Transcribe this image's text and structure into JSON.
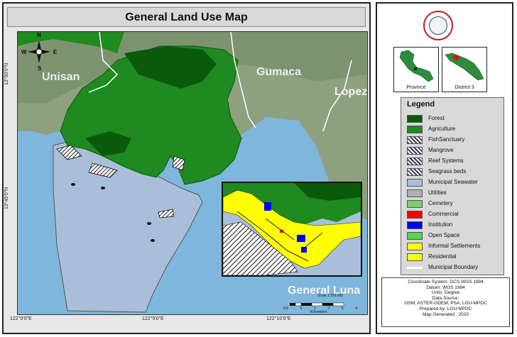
{
  "map": {
    "title": "General Land Use Map",
    "places": {
      "unisan": "Unisan",
      "gumaca": "Gumaca",
      "lopez": "Lopez",
      "general_luna": "General Luna"
    },
    "compass": {
      "n": "N",
      "s": "S",
      "e": "E",
      "w": "W"
    },
    "lat_labels": [
      "13°50'0\"N",
      "13°45'0\"N"
    ],
    "lon_labels": [
      "122°0'0\"E",
      "122°5'0\"E",
      "122°10'0\"E"
    ],
    "scale": {
      "text": "Scale 1:150,000",
      "ticks": [
        "0.5",
        "0",
        "1",
        "2",
        "3",
        "4"
      ],
      "unit": "Kilometers"
    }
  },
  "locator": {
    "province_label": "Province",
    "district_label": "District 3"
  },
  "legend": {
    "title": "Legend",
    "items": [
      {
        "label": "Forest",
        "color": "#0b5a0b",
        "pattern": "solid"
      },
      {
        "label": "Agriculture",
        "color": "#1f8a1f",
        "pattern": "solid"
      },
      {
        "label": "FishSanctuary",
        "color": "#3a3a55",
        "pattern": "hatch"
      },
      {
        "label": "Mangrove",
        "color": "#3a3a55",
        "pattern": "hatch"
      },
      {
        "label": "Reef Systems",
        "color": "#3a3a55",
        "pattern": "hatch"
      },
      {
        "label": "Seagrass beds",
        "color": "#3a3a55",
        "pattern": "hatch"
      },
      {
        "label": "Municipal Seawater",
        "color": "#a9bfd9",
        "pattern": "solid"
      },
      {
        "label": "Utilities",
        "color": "#b0b0b0",
        "pattern": "solid"
      },
      {
        "label": "Cemetery",
        "color": "#7ad06a",
        "pattern": "solid"
      },
      {
        "label": "Commercial",
        "color": "#ff0000",
        "pattern": "solid"
      },
      {
        "label": "Institution",
        "color": "#0000ff",
        "pattern": "solid"
      },
      {
        "label": "Open Space",
        "color": "#55d655",
        "pattern": "solid"
      },
      {
        "label": "Informal Settlements",
        "color": "#ffff00",
        "pattern": "solid"
      },
      {
        "label": "Residential",
        "color": "#ffff00",
        "pattern": "solid"
      },
      {
        "label": "Municipal Boundary",
        "color": "#ffffff",
        "pattern": "line"
      }
    ]
  },
  "info": {
    "lines": [
      "Coordinate System: GCS WGS 1984",
      "Datum: WGS 1984",
      "Units: Degree",
      "Data Source:",
      "OSM; ASTER-GDEM; PSA; LGU-MPDC",
      "Prepared by: LGU-MPDC",
      "Map Generated : 2020"
    ]
  },
  "colors": {
    "land": "#8da17f",
    "sea": "#7fb6dc",
    "seawater": "#a9bfd9",
    "forest": "#0b5a0b",
    "agriculture": "#1f8a1f"
  }
}
